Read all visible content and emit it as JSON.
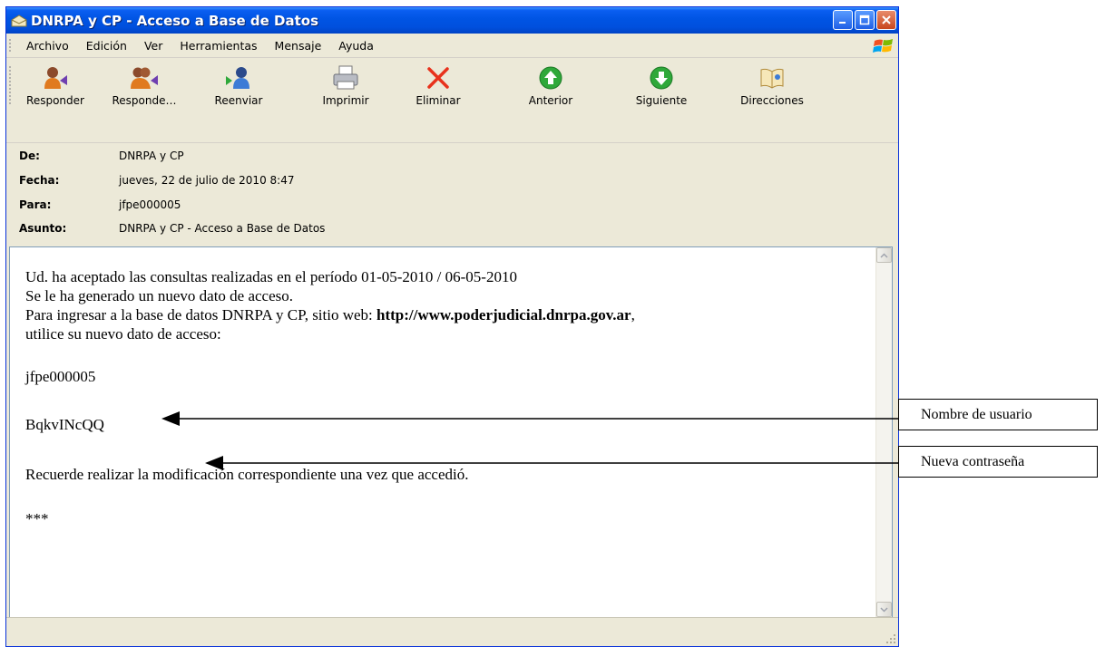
{
  "window": {
    "title": "DNRPA y CP - Acceso a Base de Datos",
    "title_icon": "envelope-icon",
    "buttons": [
      "minimize-icon",
      "maximize-icon",
      "close-icon"
    ]
  },
  "menu": {
    "items": [
      "Archivo",
      "Edición",
      "Ver",
      "Herramientas",
      "Mensaje",
      "Ayuda"
    ]
  },
  "toolbar": {
    "buttons": [
      {
        "label": "Responder",
        "icon": "reply-icon"
      },
      {
        "label": "Responde…",
        "icon": "reply-all-icon"
      },
      {
        "label": "Reenviar",
        "icon": "forward-icon"
      },
      {
        "label": "Imprimir",
        "icon": "printer-icon"
      },
      {
        "label": "Eliminar",
        "icon": "delete-icon"
      },
      {
        "label": "Anterior",
        "icon": "previous-icon"
      },
      {
        "label": "Siguiente",
        "icon": "next-icon"
      },
      {
        "label": "Direcciones",
        "icon": "address-book-icon"
      }
    ]
  },
  "header": {
    "from_label": "De:",
    "from": "DNRPA y CP",
    "date_label": "Fecha:",
    "date": "jueves, 22 de julio de 2010 8:47",
    "to_label": "Para:",
    "to": "jfpe000005",
    "subject_label": "Asunto:",
    "subject": "DNRPA y CP - Acceso a Base de Datos"
  },
  "message": {
    "line1": "Ud. ha aceptado las consultas realizadas en el período 01-05-2010 / 06-05-2010",
    "line2": "Se le ha generado un nuevo dato de acceso.",
    "line3_prefix": "Para ingresar a la base de datos DNRPA y CP, sitio web: ",
    "line3_url": "http://www.poderjudicial.dnrpa.gov.ar",
    "line3_suffix": ",",
    "line4": "utilice su nuevo dato de acceso:",
    "username": "jfpe000005",
    "password": "BqkvINcQQ",
    "reminder": "Recuerde realizar la modificación correspondiente una vez que accedió.",
    "footer": "***"
  },
  "annotations": {
    "username_label": "Nombre de usuario",
    "password_label": "Nueva contraseña"
  },
  "colors": {
    "titlebar": "#0054e3",
    "window_bg": "#ece9d8",
    "delete_red": "#e8321c",
    "nav_green": "#2fa83a"
  }
}
